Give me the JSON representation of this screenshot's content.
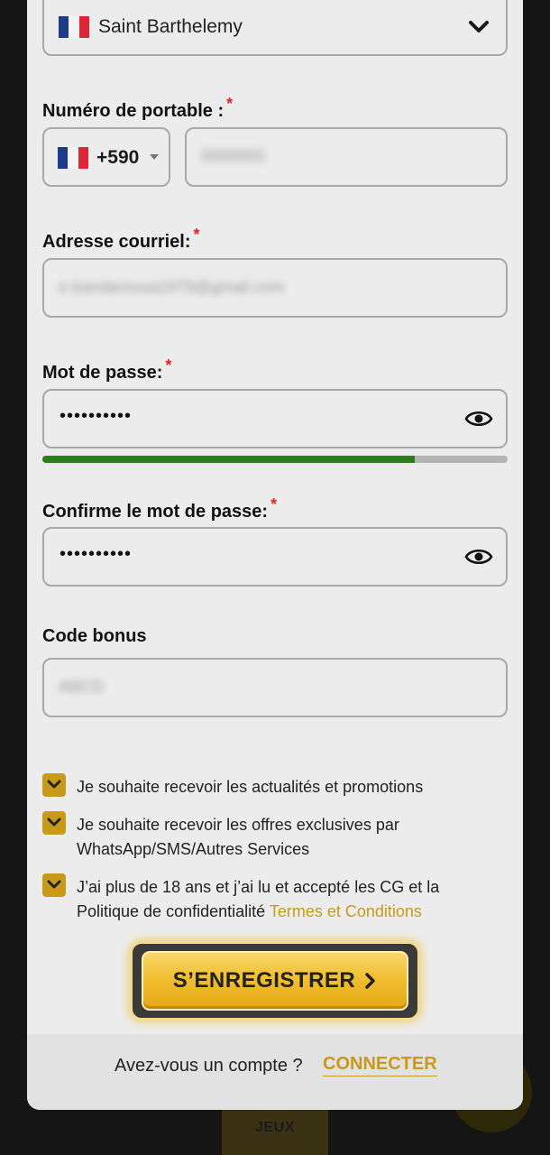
{
  "country_select": {
    "value": "Saint Barthelemy",
    "flag_icon": "france-flag-icon",
    "chevron_icon": "chevron-down-icon"
  },
  "phone": {
    "label": "Numéro de portable :",
    "required_mark": "*",
    "country_code": "+590",
    "number_value": "0000000"
  },
  "email": {
    "label": "Adresse courriel:",
    "required_mark": "*",
    "value": "e.bandamoua1979@gmail.com"
  },
  "password": {
    "label": "Mot de passe:",
    "required_mark": "*",
    "value": "••••••••••",
    "strength": 0.8
  },
  "confirm_password": {
    "label": "Confirme le mot de passe:",
    "required_mark": "*",
    "value": "••••••••••"
  },
  "bonus": {
    "label": "Code bonus",
    "value": "ABCD"
  },
  "checkboxes": [
    {
      "text": "Je souhaite recevoir les actualités et promotions",
      "checked": true
    },
    {
      "text": "Je souhaite recevoir les offres exclusives par WhatsApp/SMS/Autres Services",
      "checked": true
    },
    {
      "text": "J’ai plus de 18 ans et j’ai lu et accepté les CG et la Politique de confidentialité",
      "link": "Termes et Conditions",
      "checked": true
    }
  ],
  "register_button": {
    "label": "S’ENREGISTRER"
  },
  "footer": {
    "question": "Avez-vous un compte ?",
    "link": "CONNECTER"
  },
  "background": {
    "tab_label": "JEUX"
  },
  "colors": {
    "accent": "#c79a1a",
    "strength": "#2e7d1f",
    "required": "#e02424"
  }
}
